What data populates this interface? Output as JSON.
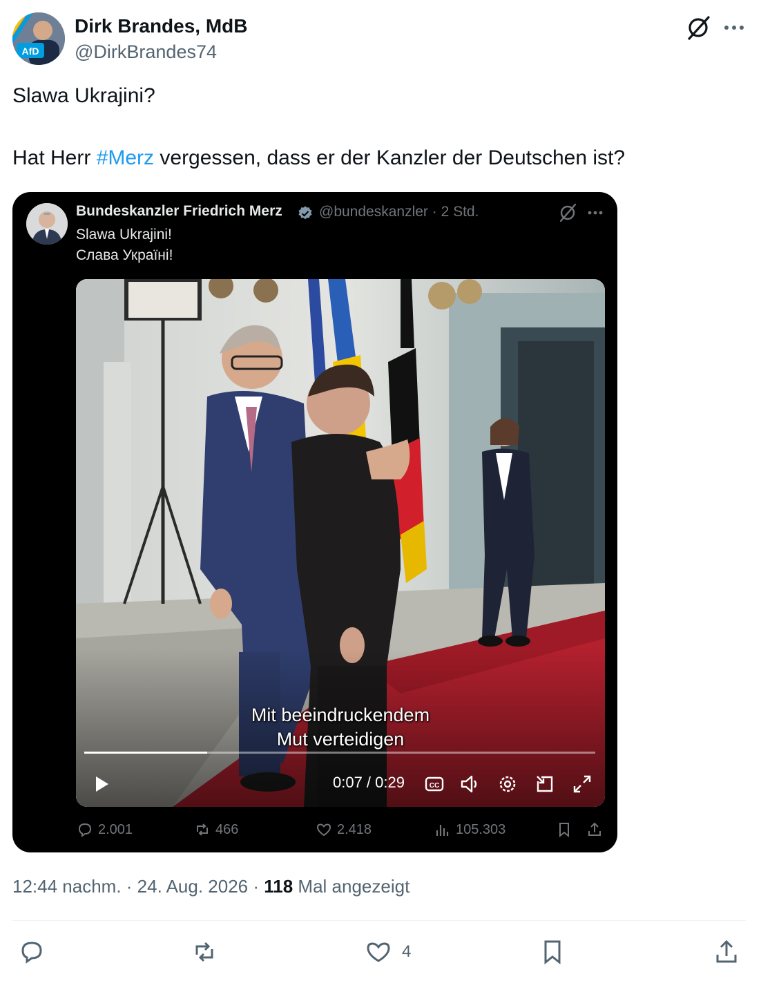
{
  "author": {
    "name": "Dirk Brandes, MdB",
    "handle": "@DirkBrandes74",
    "avatar_badge": "AfD"
  },
  "tweet": {
    "line1": "Slawa Ukrajini?",
    "line2_before": "Hat Herr ",
    "line2_hashtag": "#Merz",
    "line2_after": " vergessen, dass er der Kanzler der Deutschen ist?"
  },
  "quoted": {
    "name": "Bundeskanzler Friedrich Merz",
    "handle_time": "@bundeskanzler · 2 Std.",
    "text_line1": "Slawa Ukrajini!",
    "text_line2": "Слава Україні!",
    "video": {
      "subtitle_line1": "Mit beeindruckendem",
      "subtitle_line2": "Mut verteidigen",
      "time": "0:07 / 0:29",
      "progress": 0.24
    },
    "stats": {
      "replies": "2.001",
      "reposts": "466",
      "likes": "2.418",
      "views": "105.303"
    }
  },
  "meta": {
    "time_date": "12:44 nachm. · 24. Aug. 2026 · ",
    "views_count": "118",
    "views_label": " Mal angezeigt"
  },
  "actions": {
    "likes": "4"
  },
  "icons": [
    "grok-icon",
    "more-icon",
    "verified-icon",
    "play-icon",
    "cc-icon",
    "volume-icon",
    "settings-icon",
    "pip-icon",
    "fullscreen-icon",
    "reply-icon",
    "repost-icon",
    "like-icon",
    "views-icon",
    "bookmark-icon",
    "share-icon"
  ],
  "colors": {
    "hashtag": "#1d9bf0",
    "secondary_text": "#536471",
    "card_bg": "#000000",
    "afd_blue": "#009ee0",
    "carpet_red": "#b3202e"
  }
}
